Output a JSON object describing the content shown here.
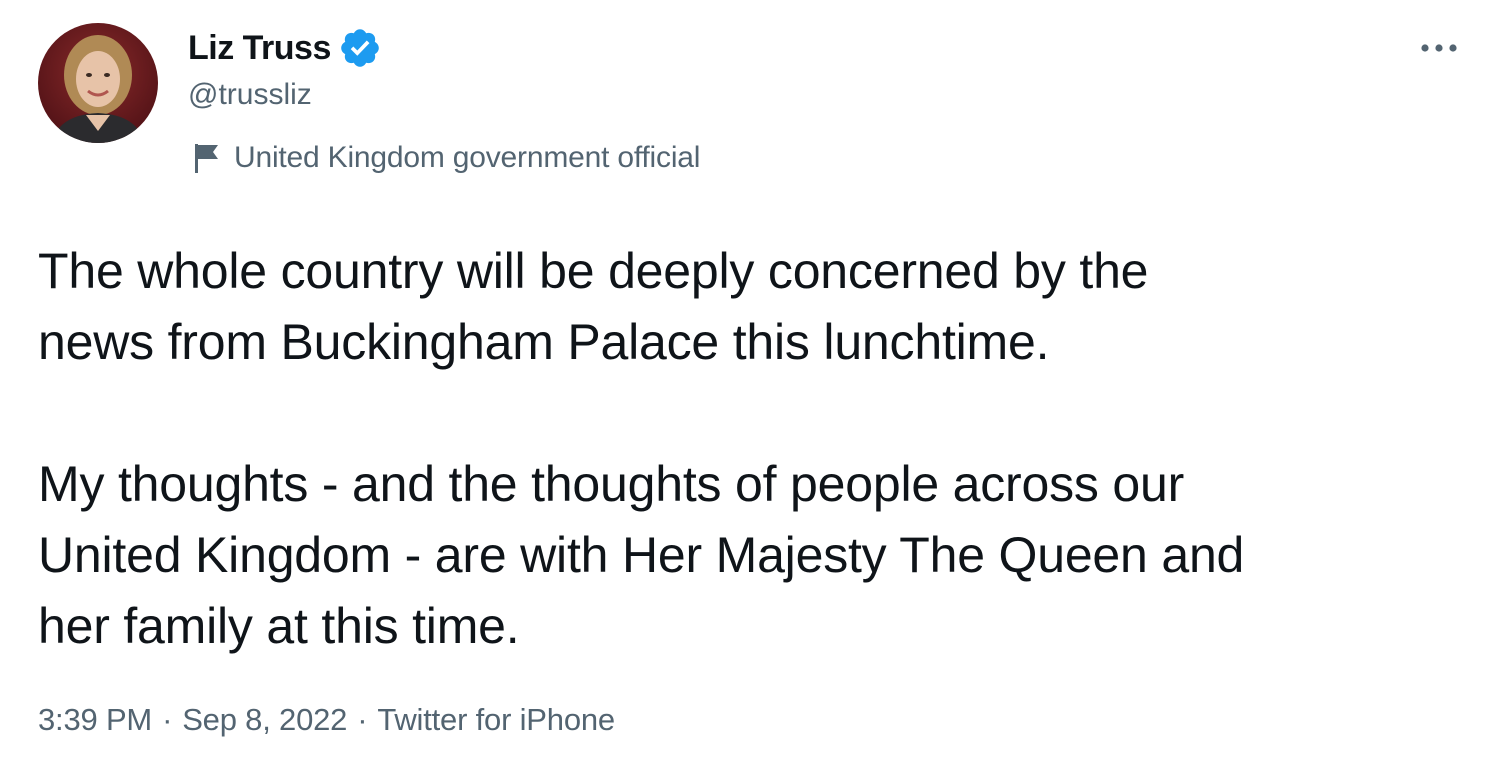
{
  "author": {
    "display_name": "Liz Truss",
    "handle": "@trussliz",
    "verified": true,
    "avatar_icon": "profile-photo",
    "label_icon": "flag-icon",
    "label": "United Kingdom government official"
  },
  "header": {
    "more_icon": "more-horizontal-icon"
  },
  "tweet": {
    "paragraphs": [
      "The whole country will be deeply concerned by the\nnews from Buckingham Palace this lunchtime.",
      "My thoughts - and the thoughts of people across our\nUnited Kingdom - are with Her Majesty The Queen and\nher family at this time."
    ]
  },
  "meta": {
    "time": "3:39 PM",
    "separator": "·",
    "date": "Sep 8, 2022",
    "source": "Twitter for iPhone"
  },
  "colors": {
    "text_primary": "#0f1419",
    "text_secondary": "#536471",
    "verified_blue": "#1d9bf0",
    "background": "#ffffff"
  }
}
